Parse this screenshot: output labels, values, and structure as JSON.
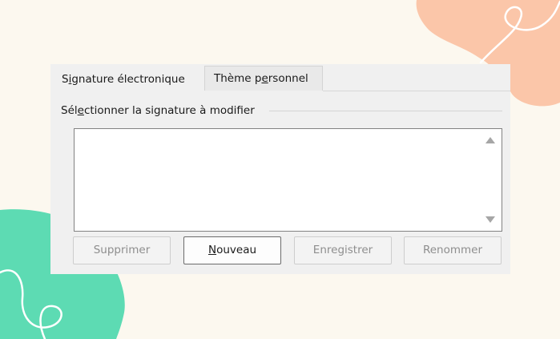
{
  "tabs": [
    {
      "label": "Signature électronique",
      "active": true
    },
    {
      "label": "Thème personnel",
      "active": false
    }
  ],
  "group": {
    "label": "Sélectionner la signature à modifier"
  },
  "signature_list": {
    "items": []
  },
  "buttons": {
    "delete": {
      "label": "Supprimer",
      "enabled": false
    },
    "new": {
      "label": "Nouveau",
      "enabled": true
    },
    "save": {
      "label": "Enregistrer",
      "enabled": false
    },
    "rename": {
      "label": "Renommer",
      "enabled": false
    }
  },
  "colors": {
    "background": "#fcf8ef",
    "blob_peach": "#fbc6a9",
    "blob_mint": "#5ddbb3",
    "dialog": "#f0f0f0",
    "disabled_text": "#8e8e8e"
  }
}
